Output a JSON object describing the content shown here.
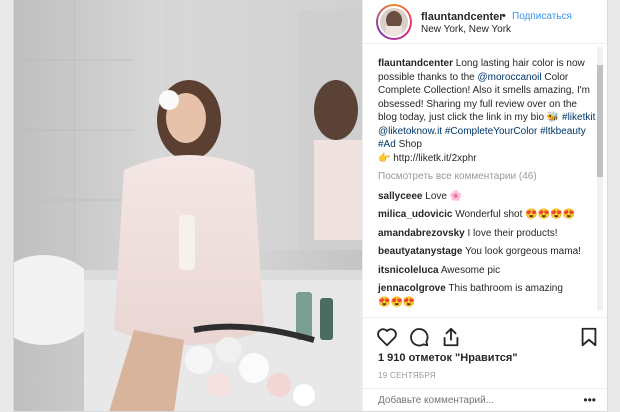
{
  "header": {
    "username": "flauntandcenter",
    "separator": "•",
    "follow_label": "Подписаться",
    "location": "New York, New York"
  },
  "caption": {
    "username": "flauntandcenter",
    "text_1": "Long lasting hair color is now possible thanks to the ",
    "mention_1": "@moroccanoil",
    "text_2": " Color Complete Collection! Also it smells amazing, I'm obsessed! Sharing my full review over on the blog today, just click the link in my bio ",
    "hashtag_1": "#liketkit",
    "mention_2": "@liketoknow.it",
    "hashtag_2": "#CompleteYourColor",
    "hashtag_3": "#ltkbeauty",
    "hashtag_4": "#Ad",
    "text_3": "Shop",
    "link": "http://liketk.it/2xphr"
  },
  "view_more": "Посмотреть все комментарии (46)",
  "comments": [
    {
      "user": "sallyceee",
      "text": "Love"
    },
    {
      "user": "milica_udovicic",
      "text": "Wonderful shot"
    },
    {
      "user": "amandabrezovsky",
      "text": "I love their products!"
    },
    {
      "user": "beautyatanystage",
      "text": "You look gorgeous mama!"
    },
    {
      "user": "itsnicoleluca",
      "text": "Awesome pic"
    },
    {
      "user": "jennacolgrove",
      "text": "This bathroom is amazing"
    }
  ],
  "likes": "1 910 отметок \"Нравится\"",
  "date": "19 СЕНТЯБРЯ",
  "add_comment_placeholder": "Добавьте комментарий...",
  "more_dots": "•••",
  "icons": [
    "heart-icon",
    "comment-icon",
    "share-icon",
    "bookmark-icon"
  ],
  "colors": {
    "link_blue": "#3897f0",
    "tag_navy": "#003569",
    "muted": "#999999"
  }
}
